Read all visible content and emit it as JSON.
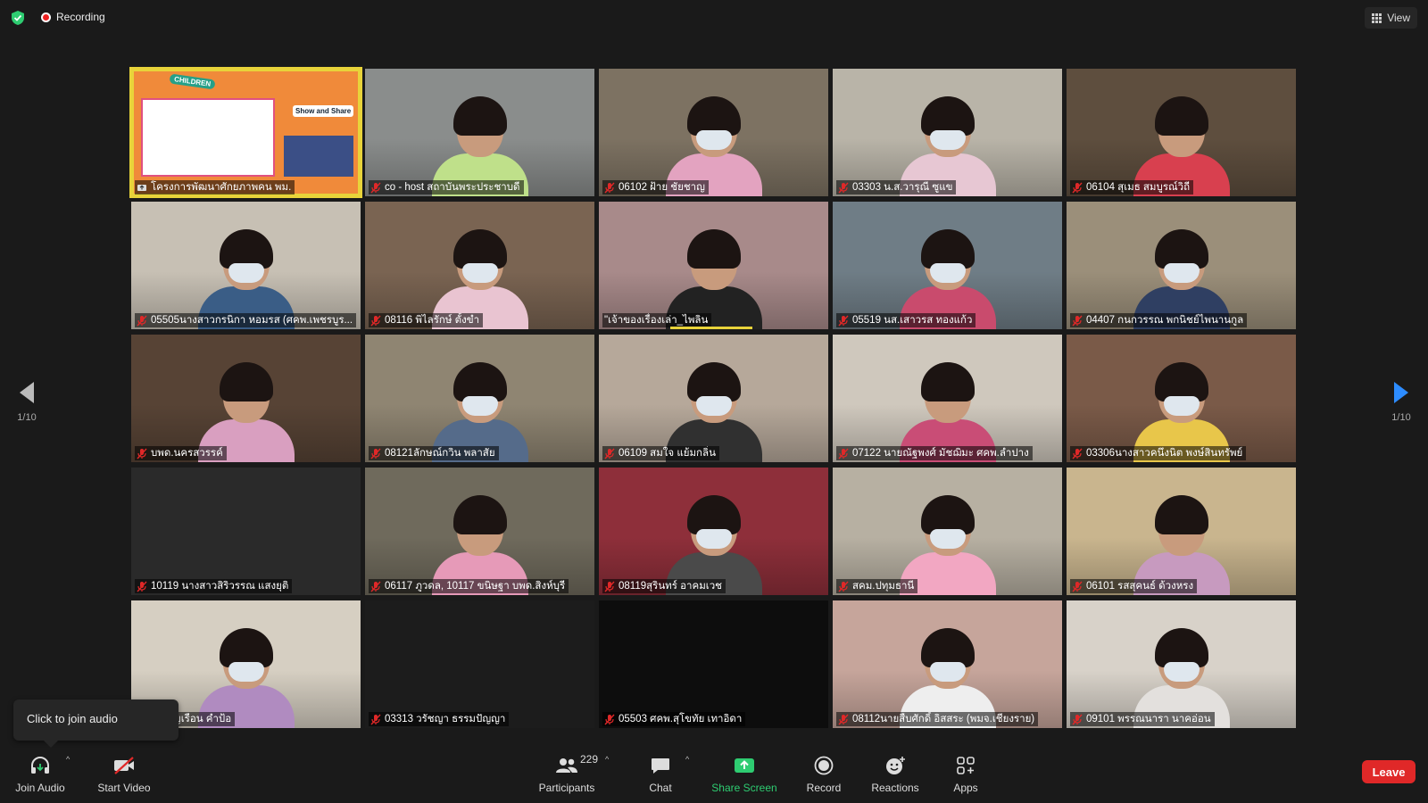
{
  "top_bar": {
    "recording_label": "Recording",
    "view_label": "View",
    "shield_color": "#2ecc71"
  },
  "gallery": {
    "page_indicator_left": "1/10",
    "page_indicator_right": "1/10",
    "active_tile_color": "#e8d33a",
    "tiles": [
      {
        "name": "โครงการพัฒนาศักยภาพคน พม.",
        "type": "share",
        "muted": false
      },
      {
        "name": "co - host สถาบันพระประชาบดี",
        "muted": true
      },
      {
        "name": "06102 ฝ้าย  ชัยชาญ",
        "muted": true
      },
      {
        "name": "03303 น.ส.วารุณี ซูแข",
        "muted": true
      },
      {
        "name": "06104 สุเมธ สมบูรณ์วิถี",
        "muted": true
      },
      {
        "name": "05505นางสาวกรนิกา หอมรส (ศคพ.เพชรบูร...",
        "muted": true
      },
      {
        "name": "08116 พิไลรักษ์ ตั้งขำ",
        "muted": true
      },
      {
        "name": "\"เจ้าของเรื่องเล่า_ไพลิน",
        "muted": false
      },
      {
        "name": "05519 นส.เสาวรส ทองแก้ว",
        "muted": true
      },
      {
        "name": "04407 กนกวรรณ พกนิชย์ไพนานกูล",
        "muted": true
      },
      {
        "name": "บพด.นครสวรรค์",
        "muted": true
      },
      {
        "name": "08121ลักษณ์กวิน พลาสัย",
        "muted": true
      },
      {
        "name": "06109 สมใจ  แย้มกลิ่น",
        "muted": true
      },
      {
        "name": "07122 นายณัฐพงศ์ มัชฌิมะ ศคพ.ลำปาง",
        "muted": true
      },
      {
        "name": "03306นางสาวคนึงนิต พงษ์สินทรัพย์",
        "muted": true
      },
      {
        "name": "10119 นางสาวสิริวรรณ แสงยุติ",
        "muted": true
      },
      {
        "name": "06117 ภูวดล, 10117 ขนิษฐา บพด.สิงห์บุรี",
        "muted": true
      },
      {
        "name": "08119สุรินทร์ อาคมเวช",
        "muted": true
      },
      {
        "name": "สคม.ปทุมธานี",
        "muted": true
      },
      {
        "name": "06101 รสสุคนธ์ ด้วงหรง",
        "muted": true
      },
      {
        "name": "2 ขวัญเรือน คำป้อ",
        "muted": true
      },
      {
        "name": "03313 วรัชญา ธรรมปัญญา",
        "muted": true
      },
      {
        "name": "05503 ศคพ.สุโขทัย เทาอิดา",
        "muted": true
      },
      {
        "name": "08112นายสืบศักดิ์ อิสสระ (พมจ.เชียงราย)",
        "muted": true
      },
      {
        "name": "09101 พรรณนารา นาคอ่อน",
        "muted": true
      }
    ],
    "share_slide": {
      "tag": "CHILDREN",
      "title": "Show and Share"
    }
  },
  "tooltip": {
    "text": "Click to join audio"
  },
  "toolbar": {
    "join_audio": "Join Audio",
    "start_video": "Start Video",
    "participants": "Participants",
    "participants_count": "229",
    "chat": "Chat",
    "share_screen": "Share Screen",
    "record": "Record",
    "reactions": "Reactions",
    "apps": "Apps",
    "leave": "Leave",
    "share_color": "#2ecc71",
    "leave_color": "#e02828"
  }
}
